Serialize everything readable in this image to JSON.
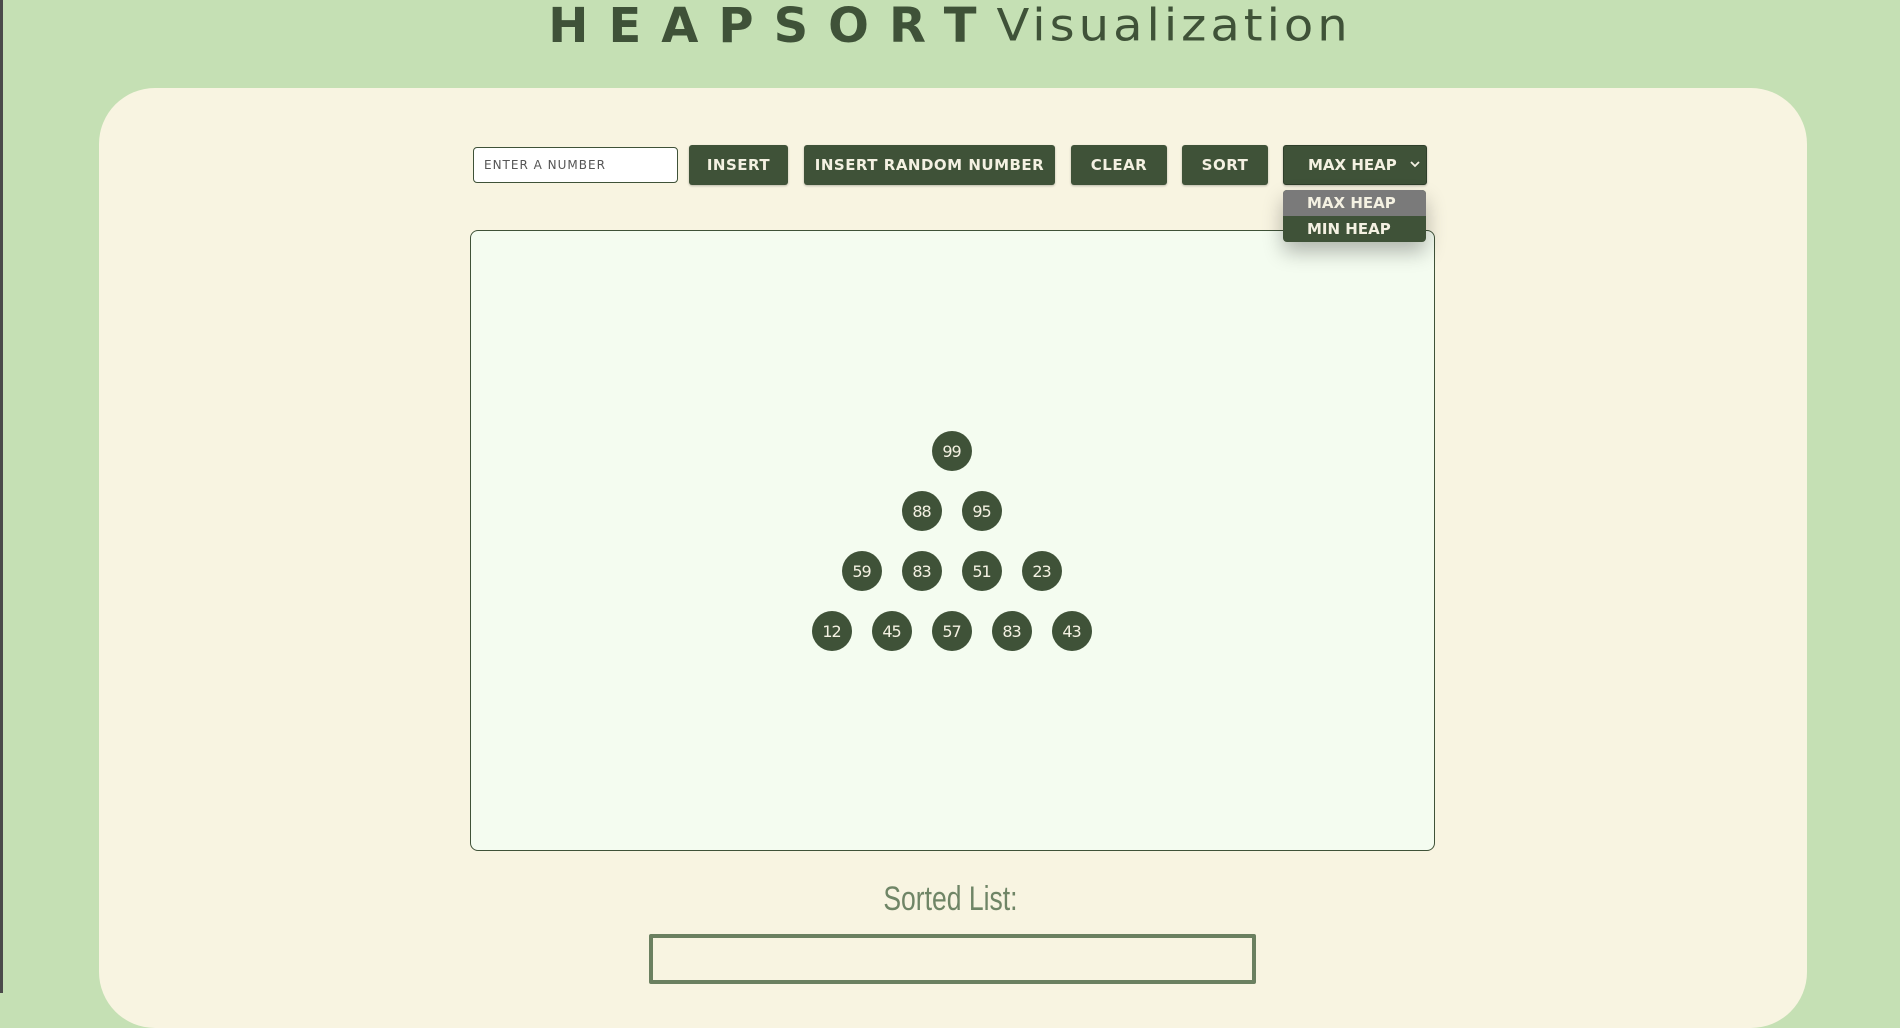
{
  "title": {
    "bold": "HEAPSORT",
    "thin": "Visualization"
  },
  "controls": {
    "input_placeholder": "ENTER A NUMBER",
    "insert_label": "INSERT",
    "insert_random_label": "INSERT RANDOM NUMBER",
    "clear_label": "CLEAR",
    "sort_label": "SORT",
    "heap_type_selected": "MAX HEAP"
  },
  "dropdown": {
    "options": [
      "MAX HEAP",
      "MIN HEAP"
    ],
    "highlighted": "MAX HEAP"
  },
  "heap": {
    "values": [
      99,
      88,
      95,
      59,
      83,
      51,
      23,
      12,
      45,
      57,
      83,
      43
    ],
    "rows": [
      [
        "99"
      ],
      [
        "88",
        "95"
      ],
      [
        "59",
        "83",
        "51",
        "23"
      ],
      [
        "12",
        "45",
        "57",
        "83",
        "43"
      ]
    ]
  },
  "sorted": {
    "title": "Sorted List:",
    "items": []
  },
  "colors": {
    "background": "#c5e0b4",
    "panel": "#f8f4e1",
    "accent": "#3f5238",
    "canvas": "#f4fcf0"
  }
}
